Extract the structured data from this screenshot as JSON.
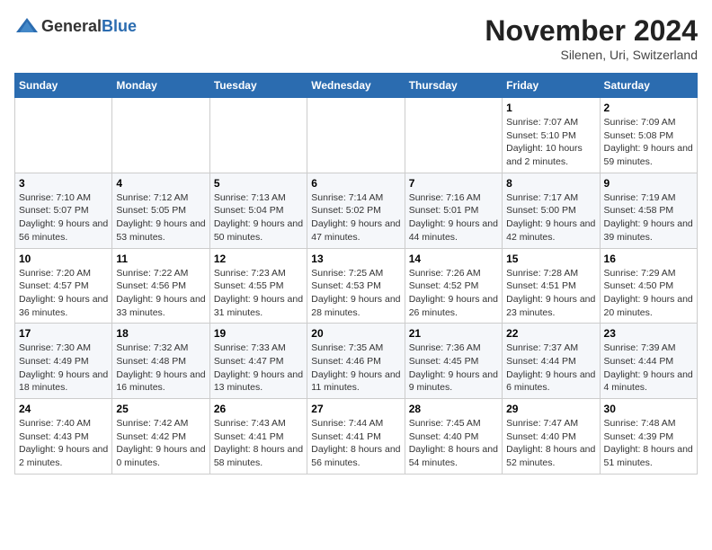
{
  "header": {
    "logo_general": "General",
    "logo_blue": "Blue",
    "month_title": "November 2024",
    "location": "Silenen, Uri, Switzerland"
  },
  "weekdays": [
    "Sunday",
    "Monday",
    "Tuesday",
    "Wednesday",
    "Thursday",
    "Friday",
    "Saturday"
  ],
  "weeks": [
    [
      {
        "day": "",
        "info": ""
      },
      {
        "day": "",
        "info": ""
      },
      {
        "day": "",
        "info": ""
      },
      {
        "day": "",
        "info": ""
      },
      {
        "day": "",
        "info": ""
      },
      {
        "day": "1",
        "info": "Sunrise: 7:07 AM\nSunset: 5:10 PM\nDaylight: 10 hours and 2 minutes."
      },
      {
        "day": "2",
        "info": "Sunrise: 7:09 AM\nSunset: 5:08 PM\nDaylight: 9 hours and 59 minutes."
      }
    ],
    [
      {
        "day": "3",
        "info": "Sunrise: 7:10 AM\nSunset: 5:07 PM\nDaylight: 9 hours and 56 minutes."
      },
      {
        "day": "4",
        "info": "Sunrise: 7:12 AM\nSunset: 5:05 PM\nDaylight: 9 hours and 53 minutes."
      },
      {
        "day": "5",
        "info": "Sunrise: 7:13 AM\nSunset: 5:04 PM\nDaylight: 9 hours and 50 minutes."
      },
      {
        "day": "6",
        "info": "Sunrise: 7:14 AM\nSunset: 5:02 PM\nDaylight: 9 hours and 47 minutes."
      },
      {
        "day": "7",
        "info": "Sunrise: 7:16 AM\nSunset: 5:01 PM\nDaylight: 9 hours and 44 minutes."
      },
      {
        "day": "8",
        "info": "Sunrise: 7:17 AM\nSunset: 5:00 PM\nDaylight: 9 hours and 42 minutes."
      },
      {
        "day": "9",
        "info": "Sunrise: 7:19 AM\nSunset: 4:58 PM\nDaylight: 9 hours and 39 minutes."
      }
    ],
    [
      {
        "day": "10",
        "info": "Sunrise: 7:20 AM\nSunset: 4:57 PM\nDaylight: 9 hours and 36 minutes."
      },
      {
        "day": "11",
        "info": "Sunrise: 7:22 AM\nSunset: 4:56 PM\nDaylight: 9 hours and 33 minutes."
      },
      {
        "day": "12",
        "info": "Sunrise: 7:23 AM\nSunset: 4:55 PM\nDaylight: 9 hours and 31 minutes."
      },
      {
        "day": "13",
        "info": "Sunrise: 7:25 AM\nSunset: 4:53 PM\nDaylight: 9 hours and 28 minutes."
      },
      {
        "day": "14",
        "info": "Sunrise: 7:26 AM\nSunset: 4:52 PM\nDaylight: 9 hours and 26 minutes."
      },
      {
        "day": "15",
        "info": "Sunrise: 7:28 AM\nSunset: 4:51 PM\nDaylight: 9 hours and 23 minutes."
      },
      {
        "day": "16",
        "info": "Sunrise: 7:29 AM\nSunset: 4:50 PM\nDaylight: 9 hours and 20 minutes."
      }
    ],
    [
      {
        "day": "17",
        "info": "Sunrise: 7:30 AM\nSunset: 4:49 PM\nDaylight: 9 hours and 18 minutes."
      },
      {
        "day": "18",
        "info": "Sunrise: 7:32 AM\nSunset: 4:48 PM\nDaylight: 9 hours and 16 minutes."
      },
      {
        "day": "19",
        "info": "Sunrise: 7:33 AM\nSunset: 4:47 PM\nDaylight: 9 hours and 13 minutes."
      },
      {
        "day": "20",
        "info": "Sunrise: 7:35 AM\nSunset: 4:46 PM\nDaylight: 9 hours and 11 minutes."
      },
      {
        "day": "21",
        "info": "Sunrise: 7:36 AM\nSunset: 4:45 PM\nDaylight: 9 hours and 9 minutes."
      },
      {
        "day": "22",
        "info": "Sunrise: 7:37 AM\nSunset: 4:44 PM\nDaylight: 9 hours and 6 minutes."
      },
      {
        "day": "23",
        "info": "Sunrise: 7:39 AM\nSunset: 4:44 PM\nDaylight: 9 hours and 4 minutes."
      }
    ],
    [
      {
        "day": "24",
        "info": "Sunrise: 7:40 AM\nSunset: 4:43 PM\nDaylight: 9 hours and 2 minutes."
      },
      {
        "day": "25",
        "info": "Sunrise: 7:42 AM\nSunset: 4:42 PM\nDaylight: 9 hours and 0 minutes."
      },
      {
        "day": "26",
        "info": "Sunrise: 7:43 AM\nSunset: 4:41 PM\nDaylight: 8 hours and 58 minutes."
      },
      {
        "day": "27",
        "info": "Sunrise: 7:44 AM\nSunset: 4:41 PM\nDaylight: 8 hours and 56 minutes."
      },
      {
        "day": "28",
        "info": "Sunrise: 7:45 AM\nSunset: 4:40 PM\nDaylight: 8 hours and 54 minutes."
      },
      {
        "day": "29",
        "info": "Sunrise: 7:47 AM\nSunset: 4:40 PM\nDaylight: 8 hours and 52 minutes."
      },
      {
        "day": "30",
        "info": "Sunrise: 7:48 AM\nSunset: 4:39 PM\nDaylight: 8 hours and 51 minutes."
      }
    ]
  ]
}
